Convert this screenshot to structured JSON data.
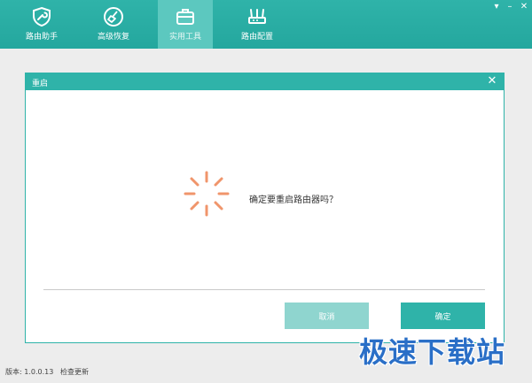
{
  "tabs": [
    {
      "label": "路由助手",
      "icon": "shield-wrench-icon"
    },
    {
      "label": "高级恢复",
      "icon": "broom-icon"
    },
    {
      "label": "实用工具",
      "icon": "toolbox-icon"
    },
    {
      "label": "路由配置",
      "icon": "router-icon"
    }
  ],
  "active_tab": "实用工具",
  "window_controls": {
    "minimize": "▾",
    "restore": "–",
    "close": "✕"
  },
  "dialog": {
    "title": "重启",
    "close": "✕",
    "message": "确定要重启路由器吗？",
    "cancel_label": "取消",
    "ok_label": "确定"
  },
  "status": {
    "version": "版本: 1.0.0.13",
    "check_update": "检查更新"
  },
  "watermark": "极速下载站",
  "colors": {
    "accent": "#2fb3a9",
    "spinner": "#f0956b"
  }
}
